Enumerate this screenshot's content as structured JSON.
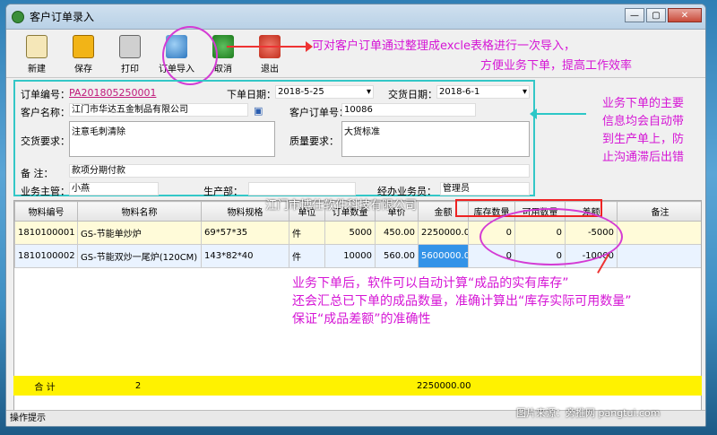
{
  "window": {
    "title": "客户订单录入"
  },
  "toolbar": {
    "new": "新建",
    "save": "保存",
    "print": "打印",
    "import": "订单导入",
    "cancel": "取消",
    "exit": "退出"
  },
  "annotations": {
    "import_line1": "可对客户订单通过整理成excle表格进行一次导入，",
    "import_line2": "方便业务下单，提高工作效率",
    "right_line1": "业务下单的主要",
    "right_line2": "信息均会自动带",
    "right_line3": "到生产单上，防",
    "right_line4": "止沟通滞后出错",
    "bottom_line1": "业务下单后，软件可以自动计算“成品的实有库存”",
    "bottom_line2": "还会汇总已下单的成品数量，准确计算出“库存实际可用数量”",
    "bottom_line3": "保证“成品差额”的准确性"
  },
  "form": {
    "order_no_label": "订单编号：",
    "order_no": "PA201805250001",
    "order_date_label": "下单日期：",
    "order_date": "2018-5-25",
    "delivery_date_label": "交货日期：",
    "delivery_date": "2018-6-1",
    "customer_label": "客户名称：",
    "customer": "江门市华达五金制品有限公司",
    "cust_order_label": "客户订单号：",
    "cust_order": "10086",
    "delivery_req_label": "交货要求：",
    "delivery_req": "注意毛刺清除",
    "quality_req_label": "质量要求：",
    "quality_req": "大货标准",
    "remark_label": "备  注：",
    "remark": "款项分期付款",
    "supervisor_label": "业务主管：",
    "supervisor": "小燕",
    "dept_label": "生产部：",
    "dept": "",
    "salesman_label": "经办业务员：",
    "salesman": "管理员"
  },
  "grid": {
    "headers": [
      "物料编号",
      "物料名称",
      "物料规格",
      "单位",
      "订单数量",
      "单价",
      "金额",
      "库存数量",
      "可用数量",
      "差额",
      "备注"
    ],
    "rows": [
      {
        "code": "1810100001",
        "name": "GS-节能单炒炉",
        "spec": "69*57*35",
        "unit": "件",
        "qty": "5000",
        "price": "450.00",
        "amount": "2250000.00",
        "stock": "0",
        "avail": "0",
        "diff": "-5000",
        "note": ""
      },
      {
        "code": "1810100002",
        "name": "GS-节能双炒一尾炉(120CM)",
        "spec": "143*82*40",
        "unit": "件",
        "qty": "10000",
        "price": "560.00",
        "amount": "5600000.00",
        "stock": "0",
        "avail": "0",
        "diff": "-10000",
        "note": ""
      }
    ],
    "total_label": "合  计",
    "total_count": "2",
    "total_amount": "2250000.00"
  },
  "status": "操作提示",
  "watermark_center": "江门市博仕软件科技有限公司",
  "watermark_source": "图片来源：旁推网 pangtui.com"
}
